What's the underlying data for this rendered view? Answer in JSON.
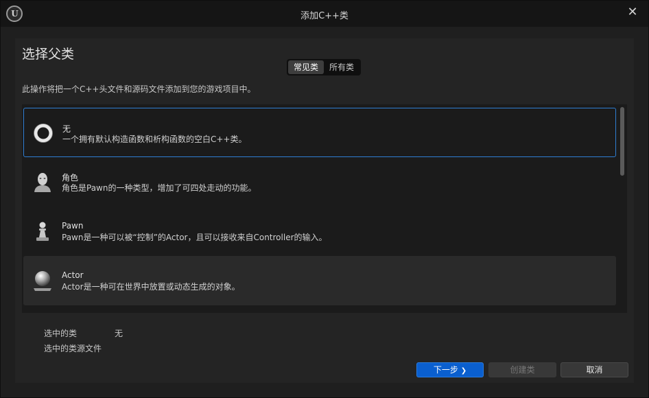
{
  "window": {
    "title": "添加C++类",
    "logo_text": "U",
    "close_glyph": "✕"
  },
  "panel": {
    "heading": "选择父类",
    "tabs": [
      {
        "label": "常见类",
        "active": true
      },
      {
        "label": "所有类",
        "active": false
      }
    ],
    "description": "此操作将把一个C++头文件和源码文件添加到您的游戏项目中。"
  },
  "classes": [
    {
      "name": "无",
      "description": "一个拥有默认构造函数和析构函数的空白C++类。",
      "icon": "ring-icon",
      "state": "selected"
    },
    {
      "name": "角色",
      "description": "角色是Pawn的一种类型，增加了可四处走动的功能。",
      "icon": "character-icon",
      "state": "normal"
    },
    {
      "name": "Pawn",
      "description": "Pawn是一种可以被“控制”的Actor，且可以接收来自Controller的输入。",
      "icon": "pawn-icon",
      "state": "normal"
    },
    {
      "name": "Actor",
      "description": "Actor是一种可在世界中放置或动态生成的对象。",
      "icon": "actor-sphere-icon",
      "state": "hovered"
    }
  ],
  "info": {
    "selected_class_label": "选中的类",
    "selected_class_value": "无",
    "source_file_label": "选中的类源文件"
  },
  "buttons": {
    "next": "下一步",
    "next_glyph": "❯",
    "create": "创建类",
    "cancel": "取消"
  },
  "colors": {
    "accent": "#0a5fcf",
    "selection_border": "#2f7fd4",
    "background": "#1f1f1f"
  }
}
